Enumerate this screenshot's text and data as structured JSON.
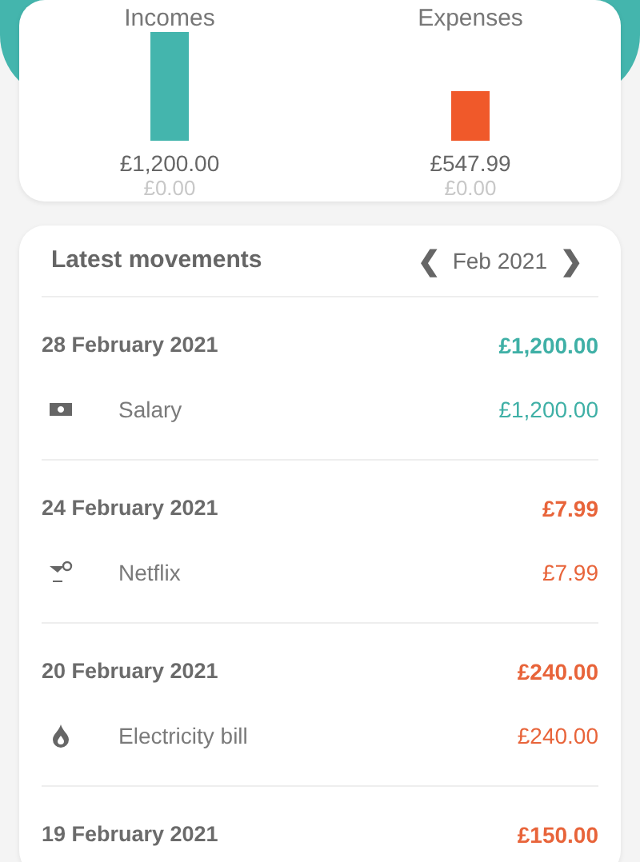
{
  "summary": {
    "chart_data": {
      "type": "bar",
      "categories": [
        "Incomes",
        "Expenses"
      ],
      "values": [
        1200,
        547.99
      ],
      "value_labels": [
        "£1,200.00",
        "£547.99"
      ]
    },
    "columns": [
      {
        "kind": "income",
        "secondary": "£0.00"
      },
      {
        "kind": "expense",
        "secondary": "£0.00"
      }
    ]
  },
  "movements": {
    "title": "Latest movements",
    "period": "Feb 2021",
    "prev": "❮",
    "next": "❯",
    "groups": [
      {
        "date": "28 February 2021",
        "total": "£1,200.00",
        "kind": "income",
        "items": [
          {
            "kind": "money",
            "name": "Salary",
            "amount": "£1,200.00"
          }
        ]
      },
      {
        "date": "24 February 2021",
        "total": "£7.99",
        "kind": "expense",
        "items": [
          {
            "kind": "cocktail",
            "name": "Netflix",
            "amount": "£7.99"
          }
        ]
      },
      {
        "date": "20 February 2021",
        "total": "£240.00",
        "kind": "expense",
        "items": [
          {
            "kind": "flame",
            "name": "Electricity bill",
            "amount": "£240.00"
          }
        ]
      },
      {
        "date": "19 February 2021",
        "total": "£150.00",
        "kind": "expense"
      }
    ]
  }
}
